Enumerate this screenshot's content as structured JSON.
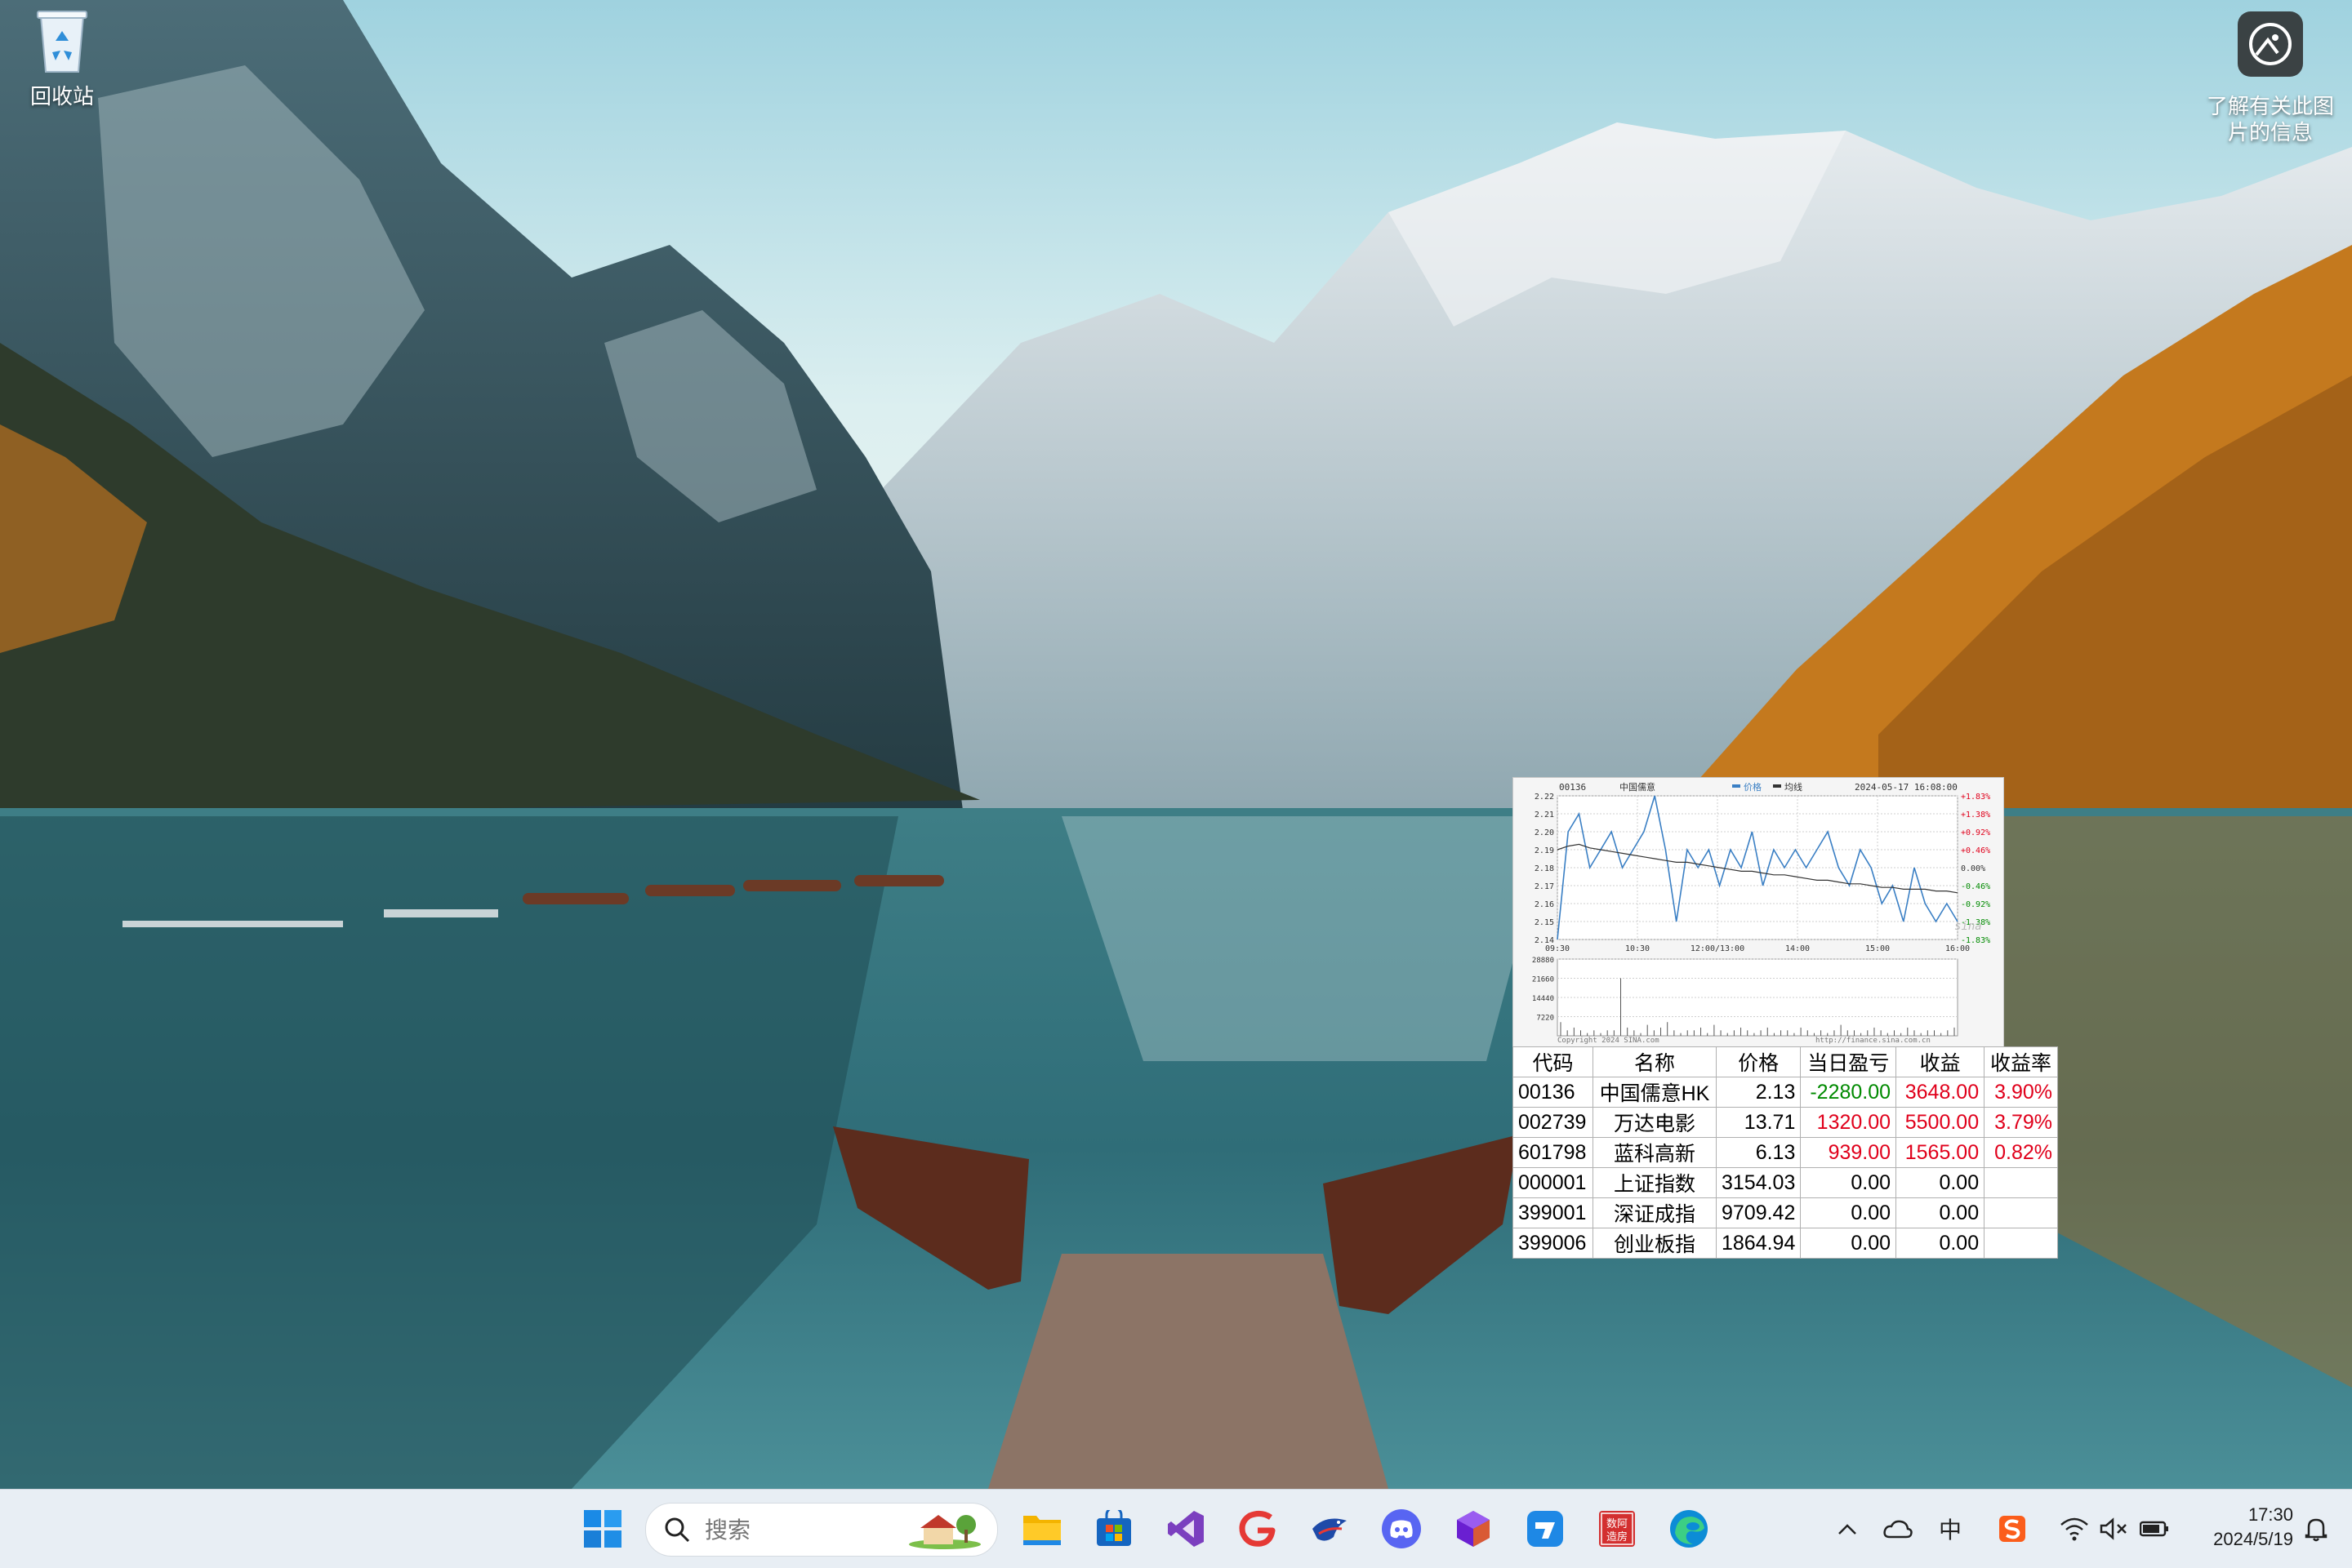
{
  "desktop": {
    "icons": [
      {
        "label": "回收站",
        "icon": "recycle-bin-icon"
      },
      {
        "label": "了解有关此图片的信息",
        "icon": "spotlight-info-icon"
      }
    ]
  },
  "stock_chart": {
    "code": "00136",
    "name": "中国儒意",
    "legend_price": "价格",
    "legend_avg": "均线",
    "datetime": "2024-05-17 16:08:00",
    "left_ticks": [
      "2.22",
      "2.21",
      "2.20",
      "2.19",
      "2.18",
      "2.17",
      "2.16",
      "2.15",
      "2.14"
    ],
    "right_ticks": [
      "+1.83%",
      "+1.38%",
      "+0.92%",
      "+0.46%",
      "0.00%",
      "-0.46%",
      "-0.92%",
      "-1.38%",
      "-1.83%"
    ],
    "time_ticks": [
      "09:30",
      "10:30",
      "12:00/13:00",
      "14:00",
      "15:00",
      "16:00"
    ],
    "volume_ticks": [
      "28880",
      "21660",
      "14440",
      "7220"
    ],
    "copyright": "Copyright 2024 SINA.com",
    "source_url": "http://finance.sina.com.cn",
    "watermark": "sina",
    "colors": {
      "price": "#3a7fc4",
      "avg": "#333333",
      "grid": "#cfcfcf",
      "up": "#e0001b",
      "down": "#008a00"
    }
  },
  "chart_data": {
    "type": "line",
    "title": "中国儒意",
    "x": [
      "09:30",
      "10:30",
      "12:00/13:00",
      "14:00",
      "15:00",
      "16:00"
    ],
    "ylim": [
      2.14,
      2.22
    ],
    "series": [
      {
        "name": "价格",
        "values": [
          2.14,
          2.2,
          2.21,
          2.18,
          2.19,
          2.2,
          2.18,
          2.19,
          2.2,
          2.22,
          2.19,
          2.15,
          2.19,
          2.18,
          2.19,
          2.17,
          2.19,
          2.18,
          2.2,
          2.17,
          2.19,
          2.18,
          2.19,
          2.18,
          2.19,
          2.2,
          2.18,
          2.17,
          2.19,
          2.18,
          2.16,
          2.17,
          2.15,
          2.18,
          2.16,
          2.15,
          2.16,
          2.15
        ]
      },
      {
        "name": "均线",
        "values": [
          2.19,
          2.192,
          2.193,
          2.191,
          2.19,
          2.189,
          2.188,
          2.187,
          2.186,
          2.185,
          2.184,
          2.183,
          2.183,
          2.182,
          2.181,
          2.18,
          2.179,
          2.178,
          2.178,
          2.177,
          2.176,
          2.176,
          2.175,
          2.174,
          2.173,
          2.173,
          2.172,
          2.171,
          2.171,
          2.17,
          2.169,
          2.169,
          2.168,
          2.168,
          2.168,
          2.167,
          2.167,
          2.166
        ]
      }
    ],
    "volume": [
      5,
      2,
      3,
      2,
      1,
      2,
      1,
      2,
      2,
      21,
      3,
      2,
      1,
      4,
      2,
      3,
      5,
      2,
      1,
      2,
      2,
      3,
      1,
      4,
      2,
      1,
      2,
      3,
      2,
      1,
      2,
      3,
      1,
      2,
      2,
      1,
      3,
      2,
      1,
      2,
      1,
      2,
      4,
      2,
      2,
      1,
      2,
      3,
      2,
      1,
      2,
      1,
      3,
      2,
      1,
      2,
      2,
      1,
      2,
      3
    ]
  },
  "table": {
    "headers": [
      "代码",
      "名称",
      "价格",
      "当日盈亏",
      "收益",
      "收益率"
    ],
    "rows": [
      {
        "code": "00136",
        "name": "中国儒意HK",
        "price": "2.13",
        "pnl": "-2280.00",
        "income": "3648.00",
        "rate": "3.90%",
        "pnl_dir": "down",
        "income_dir": "up",
        "rate_dir": "up"
      },
      {
        "code": "002739",
        "name": "万达电影",
        "price": "13.71",
        "pnl": "1320.00",
        "income": "5500.00",
        "rate": "3.79%",
        "pnl_dir": "up",
        "income_dir": "up",
        "rate_dir": "up"
      },
      {
        "code": "601798",
        "name": "蓝科高新",
        "price": "6.13",
        "pnl": "939.00",
        "income": "1565.00",
        "rate": "0.82%",
        "pnl_dir": "up",
        "income_dir": "up",
        "rate_dir": "up"
      },
      {
        "code": "000001",
        "name": "上证指数",
        "price": "3154.03",
        "pnl": "0.00",
        "income": "0.00",
        "rate": "",
        "pnl_dir": "",
        "income_dir": "",
        "rate_dir": ""
      },
      {
        "code": "399001",
        "name": "深证成指",
        "price": "9709.42",
        "pnl": "0.00",
        "income": "0.00",
        "rate": "",
        "pnl_dir": "",
        "income_dir": "",
        "rate_dir": ""
      },
      {
        "code": "399006",
        "name": "创业板指",
        "price": "1864.94",
        "pnl": "0.00",
        "income": "0.00",
        "rate": "",
        "pnl_dir": "",
        "income_dir": "",
        "rate_dir": ""
      }
    ]
  },
  "taskbar": {
    "search_placeholder": "搜索",
    "apps": [
      "start-icon",
      "file-explorer-icon",
      "microsoft-store-icon",
      "visual-studio-icon",
      "red-g-app-icon",
      "bird-app-icon",
      "discord-icon",
      "purple-cube-app-icon",
      "blue-arrow-app-icon",
      "red-stamp-app-icon",
      "edge-icon"
    ],
    "stamp_text": [
      "数阿",
      "造房"
    ],
    "tray": {
      "ime": "中",
      "time": "17:30",
      "date": "2024/5/19"
    }
  }
}
